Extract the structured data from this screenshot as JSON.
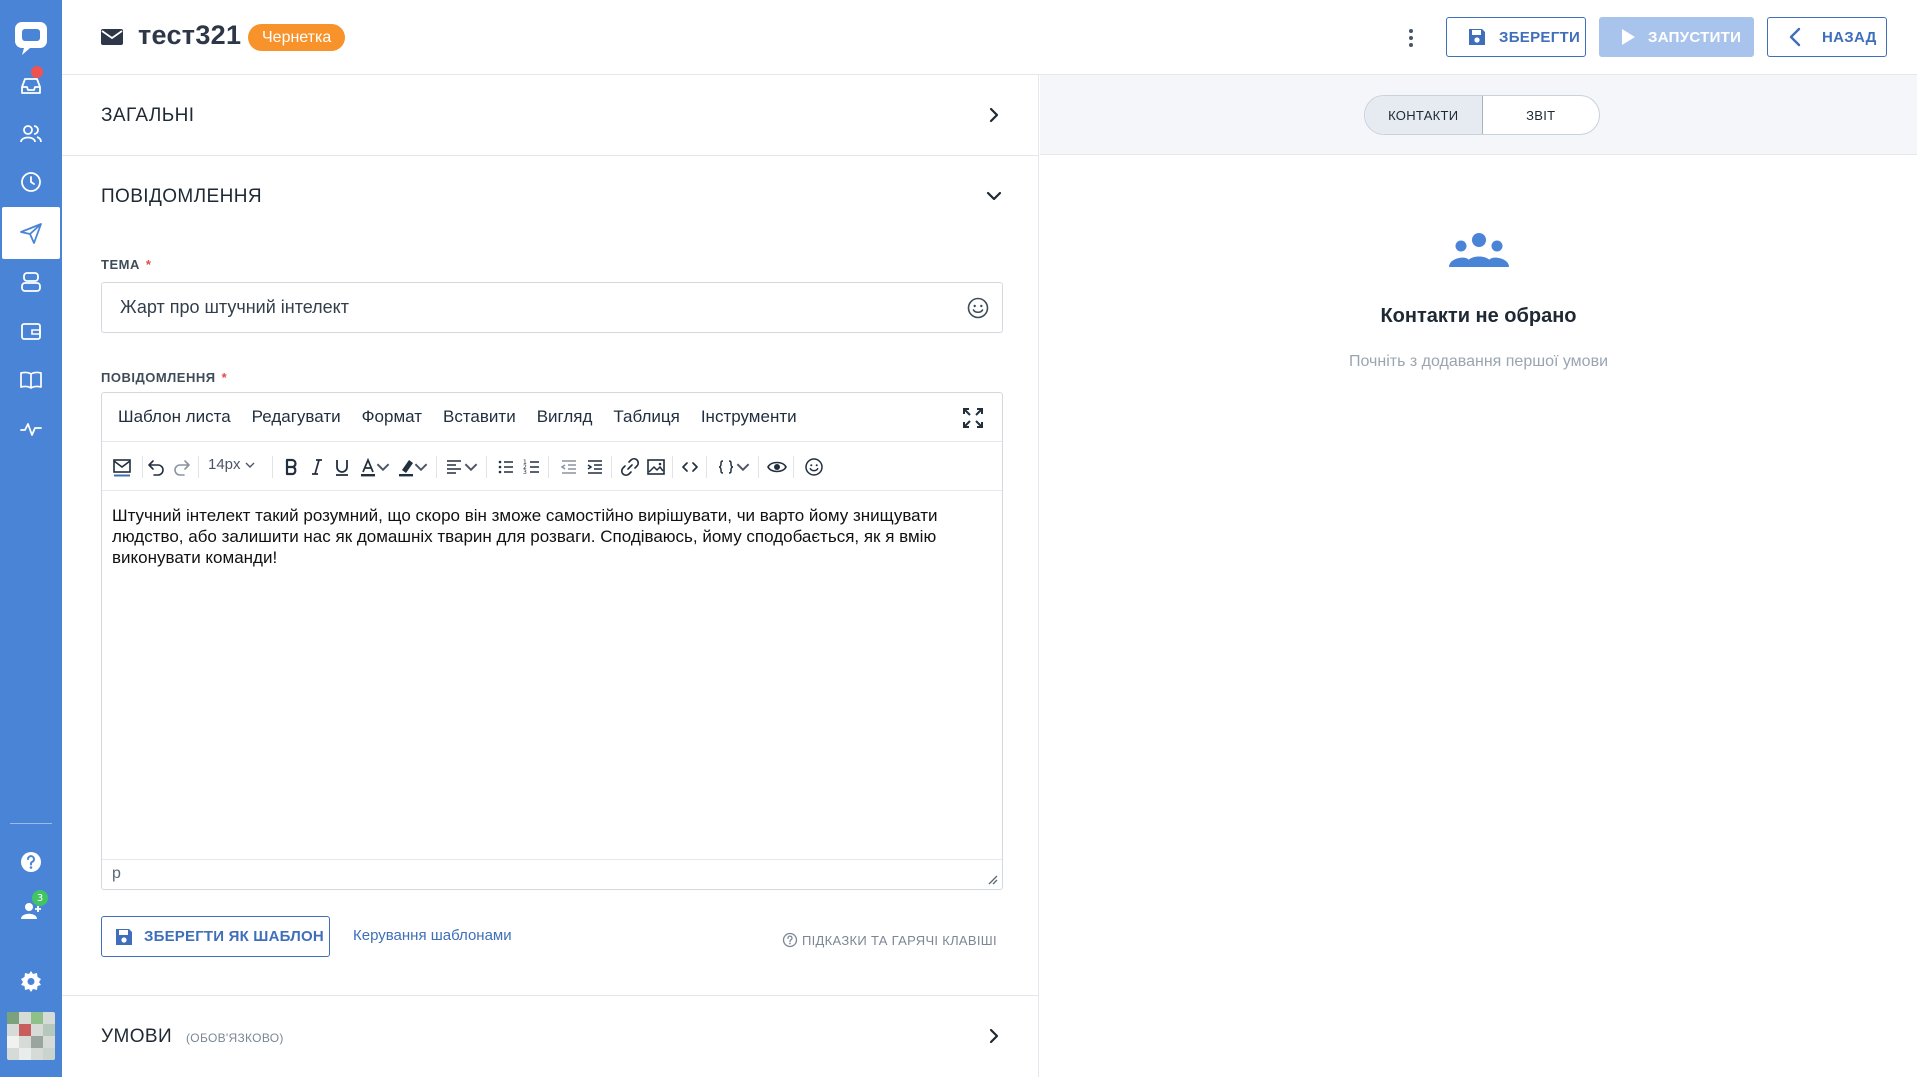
{
  "header": {
    "title": "тест321",
    "status_badge": "Чернетка",
    "save_label": "ЗБЕРЕГТИ",
    "run_label": "ЗАПУСТИТИ",
    "back_label": "НАЗАД"
  },
  "sidebar": {
    "items": [
      {
        "icon": "inbox-icon",
        "has_notification": true
      },
      {
        "icon": "contacts-icon"
      },
      {
        "icon": "history-icon"
      },
      {
        "icon": "send-icon",
        "active": true
      },
      {
        "icon": "bot-icon"
      },
      {
        "icon": "wallet-icon"
      },
      {
        "icon": "book-icon"
      },
      {
        "icon": "activity-icon"
      }
    ],
    "bottom": {
      "help_icon": "help-icon",
      "team_badge": "3",
      "settings_icon": "gear-icon"
    }
  },
  "sections": {
    "general": "ЗАГАЛЬНІ",
    "message": "ПОВІДОМЛЕННЯ",
    "conditions": "УМОВИ",
    "conditions_note": "(ОБОВ'ЯЗКОВО)"
  },
  "form": {
    "subject_label": "ТЕМА",
    "subject_value": "Жарт про штучний інтелект",
    "message_label": "ПОВІДОМЛЕННЯ",
    "required_mark": "*"
  },
  "editor": {
    "menu": [
      "Шаблон листа",
      "Редагувати",
      "Формат",
      "Вставити",
      "Вигляд",
      "Таблиця",
      "Інструменти"
    ],
    "font_size": "14px",
    "content": "Штучний інтелект такий розумний, що скоро він зможе самостійно вирішувати, чи варто йому знищувати людство, або залишити нас як домашніх тварин для розваги. Сподіваюсь, йому сподобається, як я вмію виконувати команди!",
    "path": "p"
  },
  "footer": {
    "save_template_label": "ЗБЕРЕГТИ ЯК ШАБЛОН",
    "manage_templates_label": "Керування шаблонами",
    "hints_label": "ПІДКАЗКИ ТА ГАРЯЧІ КЛАВІШІ"
  },
  "right": {
    "tabs": [
      {
        "label": "КОНТАКТИ",
        "active": true
      },
      {
        "label": "ЗВІТ"
      }
    ],
    "empty_title": "Контакти не обрано",
    "empty_subtitle": "Почніть з додавання першої умови"
  },
  "colors": {
    "sidebar": "#4a84d6",
    "accent": "#3f6fba",
    "badge": "#f8922b",
    "disabled": "#a9c4ec"
  }
}
